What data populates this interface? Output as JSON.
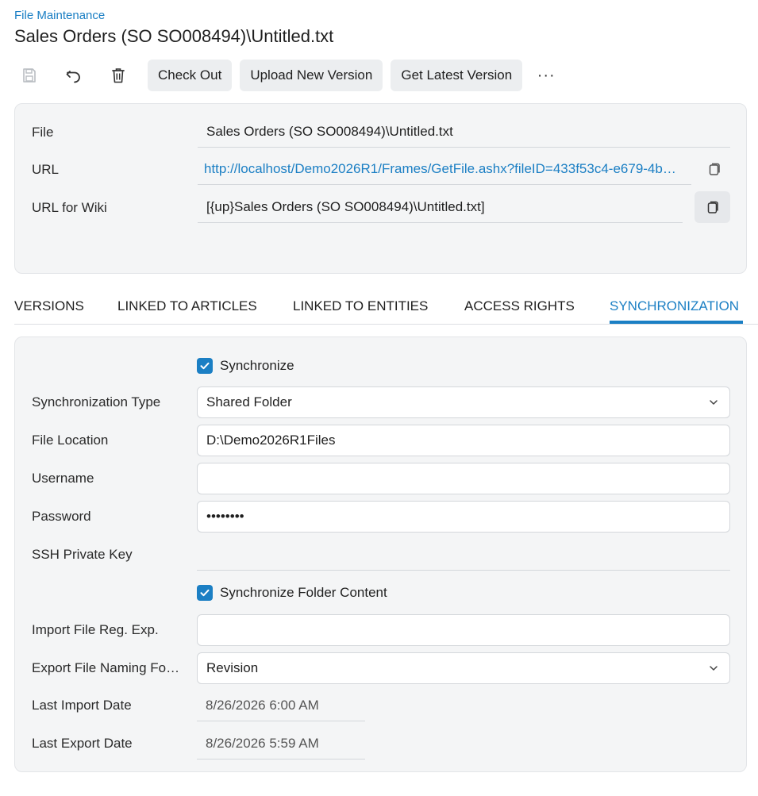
{
  "breadcrumb": "File Maintenance",
  "title": "Sales Orders (SO SO008494)\\Untitled.txt",
  "toolbar": {
    "icons": [
      "save-icon",
      "undo-icon",
      "trash-icon"
    ],
    "check_out": "Check Out",
    "upload_new_version": "Upload New Version",
    "get_latest_version": "Get Latest Version",
    "more": "···"
  },
  "summary": {
    "file_label": "File",
    "file_value": "Sales Orders (SO SO008494)\\Untitled.txt",
    "url_label": "URL",
    "url_value": "http://localhost/Demo2026R1/Frames/GetFile.ashx?fileID=433f53c4-e679-4b…",
    "wiki_label": "URL for Wiki",
    "wiki_value": "[{up}Sales Orders (SO SO008494)\\Untitled.txt]"
  },
  "tabs": [
    {
      "label": "VERSIONS",
      "active": false
    },
    {
      "label": "LINKED TO ARTICLES",
      "active": false
    },
    {
      "label": "LINKED TO ENTITIES",
      "active": false
    },
    {
      "label": "ACCESS RIGHTS",
      "active": false
    },
    {
      "label": "SYNCHRONIZATION",
      "active": true
    }
  ],
  "sync": {
    "synchronize_label": "Synchronize",
    "synchronize_checked": true,
    "sync_type_label": "Synchronization Type",
    "sync_type_value": "Shared Folder",
    "file_location_label": "File Location",
    "file_location_value": "D:\\Demo2026R1Files",
    "username_label": "Username",
    "username_value": "",
    "password_label": "Password",
    "password_value": "••••••••",
    "ssh_label": "SSH Private Key",
    "sync_folder_label": "Synchronize Folder Content",
    "sync_folder_checked": true,
    "import_regexp_label": "Import File Reg. Exp.",
    "import_regexp_value": "",
    "export_naming_label": "Export File Naming Fo…",
    "export_naming_value": "Revision",
    "last_import_label": "Last Import Date",
    "last_import_value": "8/26/2026 6:00 AM",
    "last_export_label": "Last Export Date",
    "last_export_value": "8/26/2026 5:59 AM"
  },
  "colors": {
    "accent": "#1b7fc4",
    "panel_bg": "#f4f5f6",
    "button_bg": "#eceef0"
  }
}
